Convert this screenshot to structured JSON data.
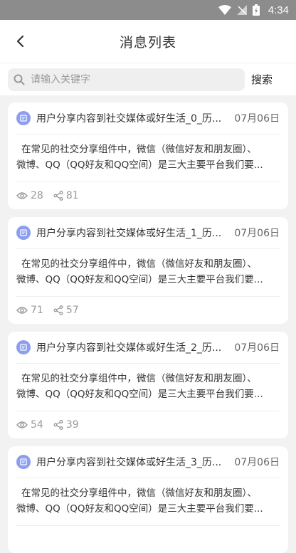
{
  "status": {
    "time": "4:34"
  },
  "header": {
    "title": "消息列表"
  },
  "search": {
    "placeholder": "请输入关键字",
    "button_label": "搜索"
  },
  "messages": [
    {
      "title": "用户分享内容到社交媒体或好生活_0_历...",
      "date": "07月06日",
      "body_line1": "在常见的社交分享组件中，微信（微信好友和朋友圈）、",
      "body_line2": "微博、QQ（QQ好友和QQ空间）是三大主要平台我们要...",
      "views": "28",
      "shares": "81"
    },
    {
      "title": "用户分享内容到社交媒体或好生活_1_历...",
      "date": "07月06日",
      "body_line1": "在常见的社交分享组件中，微信（微信好友和朋友圈）、",
      "body_line2": "微博、QQ（QQ好友和QQ空间）是三大主要平台我们要...",
      "views": "71",
      "shares": "57"
    },
    {
      "title": "用户分享内容到社交媒体或好生活_2_历...",
      "date": "07月06日",
      "body_line1": "在常见的社交分享组件中，微信（微信好友和朋友圈）、",
      "body_line2": "微博、QQ（QQ好友和QQ空间）是三大主要平台我们要...",
      "views": "54",
      "shares": "39"
    },
    {
      "title": "用户分享内容到社交媒体或好生活_3_历...",
      "date": "07月06日",
      "body_line1": "在常见的社交分享组件中，微信（微信好友和朋友圈）、",
      "body_line2": "微博、QQ（QQ好友和QQ空间）是三大主要平台我们要...",
      "views": "",
      "shares": ""
    }
  ]
}
